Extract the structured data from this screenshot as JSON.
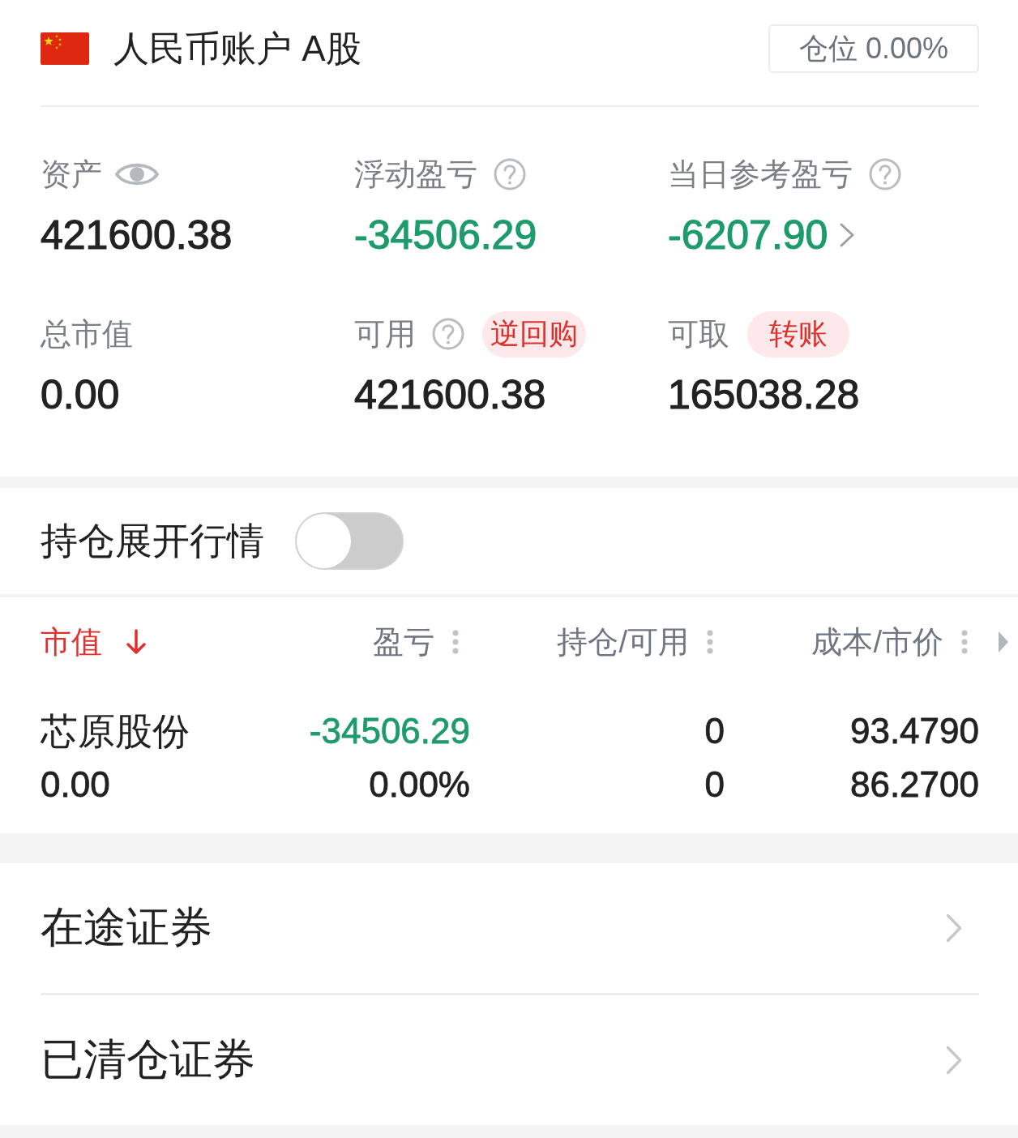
{
  "account": {
    "title": "人民币账户 A股",
    "position_button": "仓位 0.00%"
  },
  "stats": [
    {
      "label": "资产",
      "kind": "eye",
      "value": "421600.38",
      "color": "#222222"
    },
    {
      "label": "浮动盈亏",
      "kind": "help",
      "value": "-34506.29",
      "color": "#1e9b6b"
    },
    {
      "label": "当日参考盈亏",
      "kind": "help",
      "value": "-6207.90",
      "color": "#1e9b6b",
      "chevron": true
    },
    {
      "label": "总市值",
      "kind": "plain",
      "value": "0.00",
      "color": "#222222"
    },
    {
      "label": "可用",
      "kind": "help",
      "badge": "逆回购",
      "value": "421600.38",
      "color": "#222222"
    },
    {
      "label": "可取",
      "kind": "plain",
      "badge": "转账",
      "value": "165038.28",
      "color": "#222222"
    }
  ],
  "toggle": {
    "label": "持仓展开行情",
    "on": false
  },
  "table": {
    "columns": [
      {
        "label": "市值",
        "selected": true
      },
      {
        "label": "盈亏",
        "selected": false
      },
      {
        "label": "持仓/可用",
        "selected": false
      },
      {
        "label": "成本/市价",
        "selected": false
      }
    ],
    "rows": [
      {
        "name": "芯原股份",
        "market_value": "0.00",
        "pnl": {
          "text": "-34506.29",
          "color": "#1e9b6b"
        },
        "pnl_ratio": "0.00%",
        "holding": "0",
        "available": "0",
        "cost": "93.4790",
        "price": "86.2700"
      }
    ]
  },
  "links": [
    {
      "label": "在途证券"
    },
    {
      "label": "已清仓证券"
    }
  ]
}
